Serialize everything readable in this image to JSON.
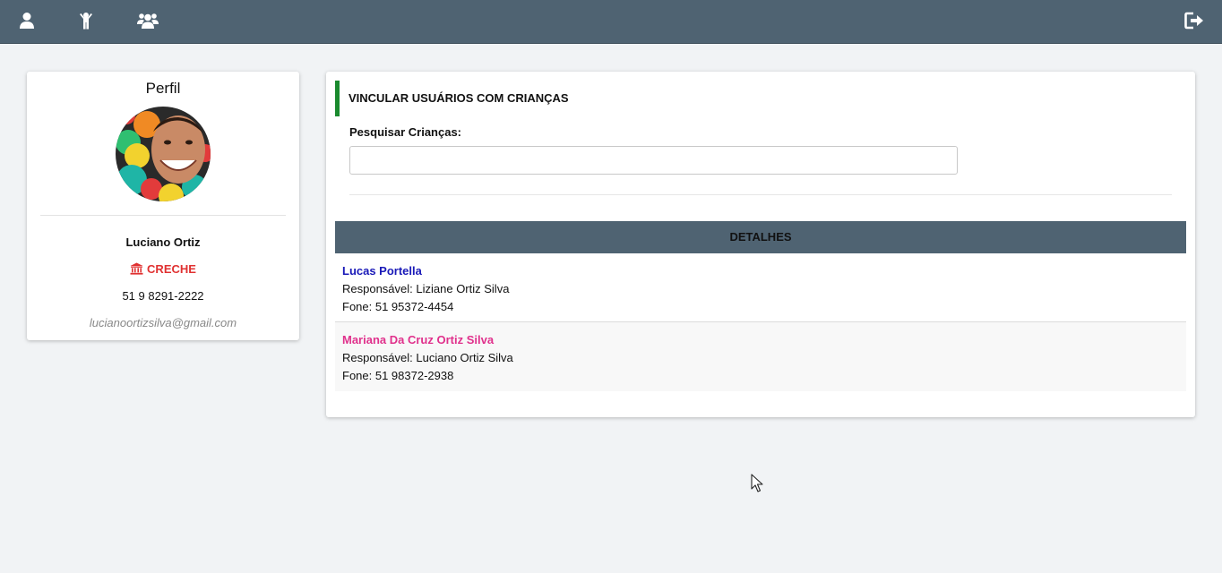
{
  "topbar": {
    "icons": [
      "user-icon",
      "child-icon",
      "users-icon",
      "sign-out-icon"
    ],
    "background": "#4f6372"
  },
  "profile": {
    "title": "Perfil",
    "name": "Luciano Ortiz",
    "role": "CRECHE",
    "role_icon": "institution-icon",
    "role_color": "#e03131",
    "phone": "51 9 8291-2222",
    "email": "lucianoortizsilva@gmail.com"
  },
  "link_section": {
    "title": "VINCULAR USUÁRIOS COM CRIANÇAS",
    "accent_color": "#1a8a2e",
    "search": {
      "label": "Pesquisar Crianças:",
      "value": "",
      "placeholder": ""
    },
    "table": {
      "header": "DETALHES",
      "rows": [
        {
          "name": "Lucas Portella",
          "name_color": "#1a1ab8",
          "responsavel": "Responsável: Liziane Ortiz Silva",
          "fone": "Fone: 51 95372-4454"
        },
        {
          "name": "Mariana Da Cruz Ortiz Silva",
          "name_color": "#e0318c",
          "responsavel": "Responsável: Luciano Ortiz Silva",
          "fone": "Fone: 51 98372-2938"
        }
      ]
    }
  }
}
